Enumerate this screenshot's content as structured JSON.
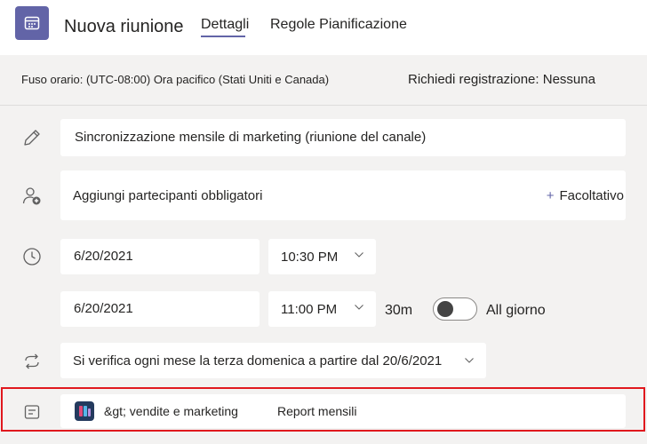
{
  "header": {
    "title": "Nuova riunione",
    "tabs": [
      {
        "label": "Dettagli",
        "active": true
      },
      {
        "label": "Regole Pianificazione",
        "active": false
      }
    ],
    "accent_color": "#6264a7"
  },
  "info": {
    "timezone": "Fuso orario: (UTC-08:00) Ora pacifico (Stati Uniti e Canada)",
    "registration": "Richiedi registrazione: Nessuna"
  },
  "form": {
    "title_value": "Sincronizzazione mensile di marketing (riunione del canale)",
    "attendees_placeholder": "Aggiungi partecipanti obbligatori",
    "optional_label": "Facoltativo",
    "start_date": "6/20/2021",
    "start_time": "10:30 PM",
    "end_date": "6/20/2021",
    "end_time": "11:00 PM",
    "duration": "30m",
    "all_day_label": "All giorno",
    "all_day_on": false,
    "recurrence": "Si verifica ogni mese la terza domenica a partire dal 20/6/2021",
    "team": "&gt; vendite e marketing",
    "channel": "Report mensili"
  },
  "icons": {
    "app": "calendar-icon",
    "title_row": "pencil-icon",
    "attendees_row": "add-person-icon",
    "time_row": "clock-icon",
    "recur_row": "repeat-icon",
    "channel_row": "channel-icon",
    "team": "team-avatar-icon",
    "dropdown": "chevron-down-icon"
  },
  "highlight_color": "#e0181e"
}
